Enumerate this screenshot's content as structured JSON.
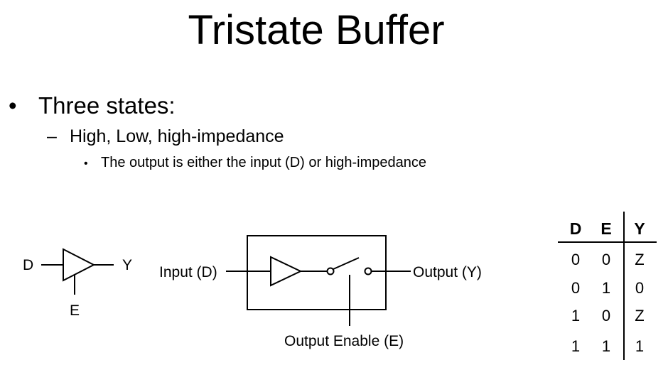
{
  "title": "Tristate Buffer",
  "bullets": {
    "level1": "Three states:",
    "level2": "High, Low, high-impedance",
    "level3": "The output is either the input (D) or high-impedance"
  },
  "symbol": {
    "input_label": "D",
    "output_label": "Y",
    "enable_label": "E"
  },
  "schematic": {
    "input_label": "Input (D)",
    "output_label": "Output (Y)",
    "enable_label": "Output Enable (E)"
  },
  "truth_table": {
    "headers": [
      "D",
      "E",
      "Y"
    ],
    "rows": [
      [
        "0",
        "0",
        "Z"
      ],
      [
        "0",
        "1",
        "0"
      ],
      [
        "1",
        "0",
        "Z"
      ],
      [
        "1",
        "1",
        "1"
      ]
    ]
  }
}
